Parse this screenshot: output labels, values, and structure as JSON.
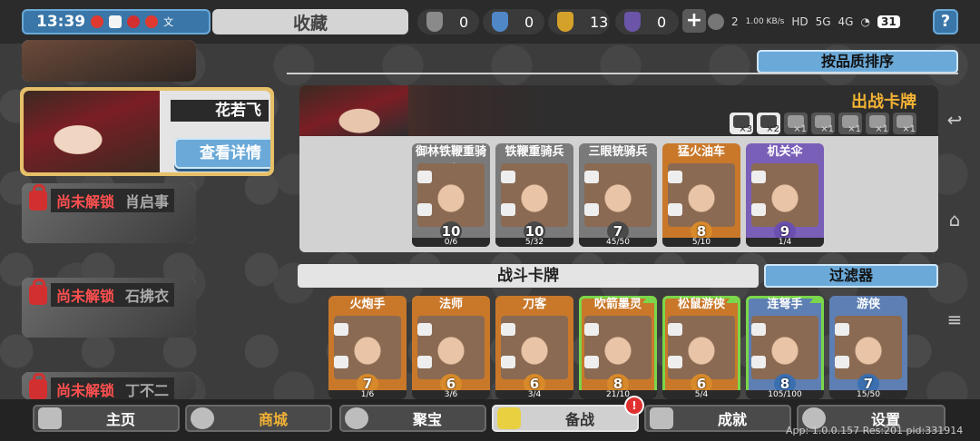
{
  "status": {
    "time": "13:39",
    "gl": "文"
  },
  "tab_title": "收藏",
  "resources": [
    {
      "icon": "shield-grey-icon",
      "value": "0",
      "color": "#8a8a8a"
    },
    {
      "icon": "shield-blue-icon",
      "value": "0",
      "color": "#4f87c7"
    },
    {
      "icon": "shield-gold-icon",
      "value": "13",
      "color": "#d4a12a"
    },
    {
      "icon": "shield-purple-icon",
      "value": "0",
      "color": "#6a55a8"
    }
  ],
  "system": {
    "net": "1.00 KB/s",
    "hd": "HD",
    "sig": "5G",
    "sig2": "4G",
    "battery": "31",
    "partial_number": "2"
  },
  "heroes": {
    "selected": {
      "name": "花若飞",
      "detail_button": "查看详情"
    },
    "locked": [
      {
        "status": "尚未解锁",
        "name": "肖启事"
      },
      {
        "status": "尚未解锁",
        "name": "石拂衣"
      },
      {
        "status": "尚未解锁",
        "name": "丁不二"
      }
    ]
  },
  "sort_button": "按品质排序",
  "deck": {
    "title": "出战卡牌",
    "tags": [
      {
        "icon": "unit-tag-icon",
        "count": "×3",
        "active": true
      },
      {
        "icon": "shield-tag-icon",
        "count": "×2",
        "active": true
      },
      {
        "icon": "ranged-tag-icon",
        "count": "×1",
        "active": false
      },
      {
        "icon": "wheel-tag-icon",
        "count": "×1",
        "active": false
      },
      {
        "icon": "gear-tag-icon",
        "count": "×1",
        "active": false
      },
      {
        "icon": "sword-tag-icon",
        "count": "×1",
        "active": false
      },
      {
        "icon": "helmet-tag-icon",
        "count": "×1",
        "active": false
      }
    ],
    "cards": [
      {
        "name": "御林铁鞭重骑兵",
        "level": "10",
        "progress": "0/6",
        "color": "grey"
      },
      {
        "name": "铁鞭重骑兵",
        "level": "10",
        "progress": "5/32",
        "color": "grey"
      },
      {
        "name": "三眼铳骑兵",
        "level": "7",
        "progress": "45/50",
        "color": "grey"
      },
      {
        "name": "猛火油车",
        "level": "8",
        "progress": "5/10",
        "color": "orange"
      },
      {
        "name": "机关伞",
        "level": "9",
        "progress": "1/4",
        "color": "purple"
      }
    ]
  },
  "battle": {
    "title": "战斗卡牌",
    "filter_button": "过滤器",
    "cards": [
      {
        "name": "火炮手",
        "level": "7",
        "progress": "1/6",
        "color": "orange",
        "upgrade": false
      },
      {
        "name": "法师",
        "level": "6",
        "progress": "3/6",
        "color": "orange",
        "upgrade": false
      },
      {
        "name": "刀客",
        "level": "6",
        "progress": "3/4",
        "color": "orange",
        "upgrade": false
      },
      {
        "name": "吹箭墨灵",
        "level": "8",
        "progress": "21/10",
        "color": "orange",
        "upgrade": true
      },
      {
        "name": "松鼠游侠",
        "level": "6",
        "progress": "5/4",
        "color": "orange",
        "upgrade": true
      },
      {
        "name": "连弩手",
        "level": "8",
        "progress": "105/100",
        "color": "blue",
        "upgrade": true
      },
      {
        "name": "游侠",
        "level": "7",
        "progress": "15/50",
        "color": "blue",
        "upgrade": false
      }
    ]
  },
  "nav": [
    {
      "label": "主页",
      "icon": "home-icon"
    },
    {
      "label": "商城",
      "icon": "coins-icon"
    },
    {
      "label": "聚宝",
      "icon": "treasure-icon"
    },
    {
      "label": "备战",
      "icon": "cards-icon"
    },
    {
      "label": "成就",
      "icon": "achievement-icon"
    },
    {
      "label": "设置",
      "icon": "gear-icon"
    }
  ],
  "nav_badge": "!",
  "app_info": "App: 1.0.0.157 Res:201 pid:331914"
}
